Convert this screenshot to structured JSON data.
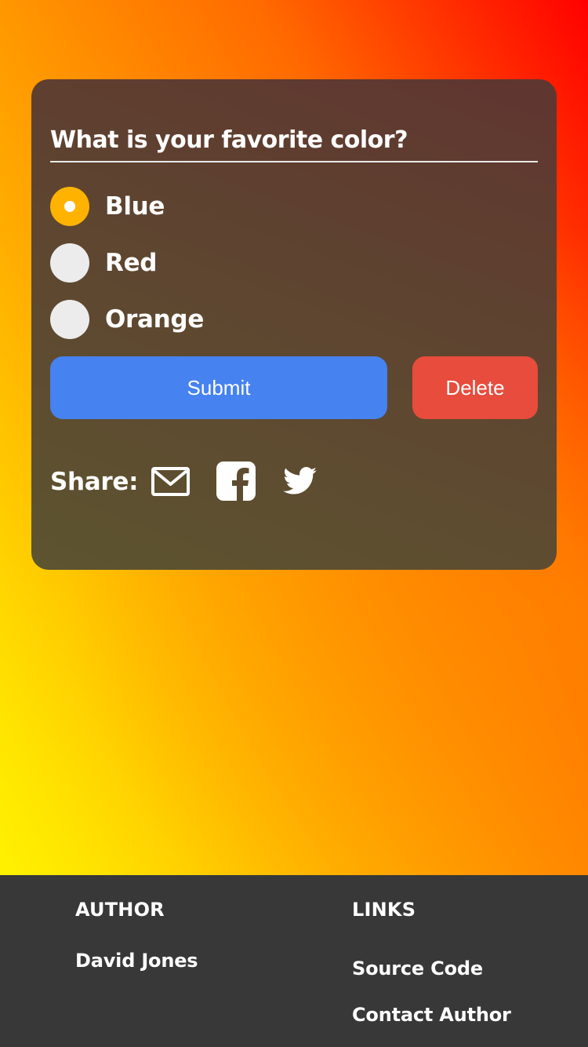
{
  "poll": {
    "question": "What is your favorite color?",
    "options": [
      {
        "label": "Blue",
        "checked": true
      },
      {
        "label": "Red",
        "checked": false
      },
      {
        "label": "Orange",
        "checked": false
      }
    ],
    "submit_label": "Submit",
    "delete_label": "Delete",
    "share_label": "Share:",
    "share_icons": [
      "mail-icon",
      "facebook-icon",
      "twitter-icon"
    ]
  },
  "footer": {
    "author_heading": "AUTHOR",
    "author_name": "David Jones",
    "links_heading": "LINKS",
    "links": [
      "Source Code",
      "Contact Author"
    ]
  },
  "colors": {
    "radio_checked": "#ffb300",
    "submit": "#4682f0",
    "delete": "#e74c3c",
    "footer_bg": "#383838"
  }
}
